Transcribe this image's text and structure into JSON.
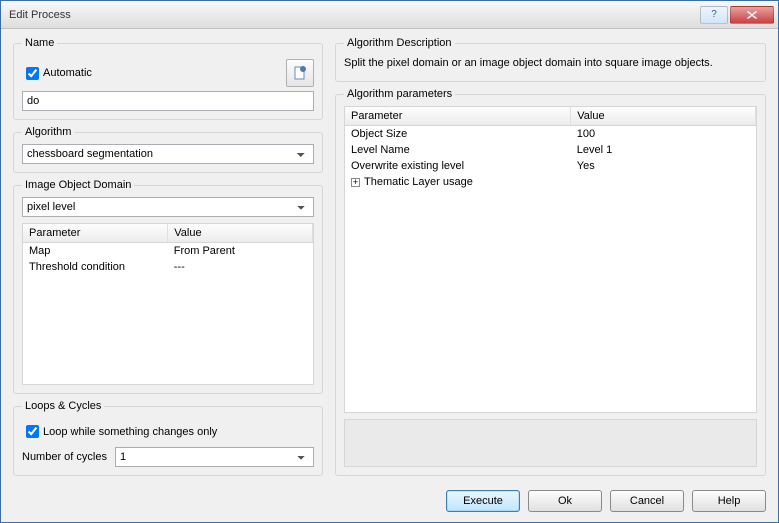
{
  "window": {
    "title": "Edit Process"
  },
  "name_section": {
    "legend": "Name",
    "automatic_label": "Automatic",
    "automatic_checked": true,
    "value": "do"
  },
  "algorithm_section": {
    "legend": "Algorithm",
    "selected": "chessboard segmentation"
  },
  "domain_section": {
    "legend": "Image Object Domain",
    "selected": "pixel level",
    "headers": {
      "param": "Parameter",
      "value": "Value"
    },
    "rows": [
      {
        "param": "Map",
        "value": "From Parent"
      },
      {
        "param": "Threshold condition",
        "value": "---"
      }
    ]
  },
  "loops_section": {
    "legend": "Loops & Cycles",
    "loop_label": "Loop while something changes only",
    "loop_checked": true,
    "cycles_label": "Number of cycles",
    "cycles_value": "1"
  },
  "desc_section": {
    "legend": "Algorithm Description",
    "text": "Split the pixel domain or an image object domain into square image objects."
  },
  "algo_params_section": {
    "legend": "Algorithm parameters",
    "headers": {
      "param": "Parameter",
      "value": "Value"
    },
    "rows": [
      {
        "param": "Object Size",
        "value": "100"
      },
      {
        "param": "Level Name",
        "value": "Level 1"
      },
      {
        "param": "Overwrite existing level",
        "value": "Yes"
      },
      {
        "param": "Thematic Layer usage",
        "value": "",
        "expandable": true
      }
    ]
  },
  "buttons": {
    "execute": "Execute",
    "ok": "Ok",
    "cancel": "Cancel",
    "help": "Help"
  }
}
